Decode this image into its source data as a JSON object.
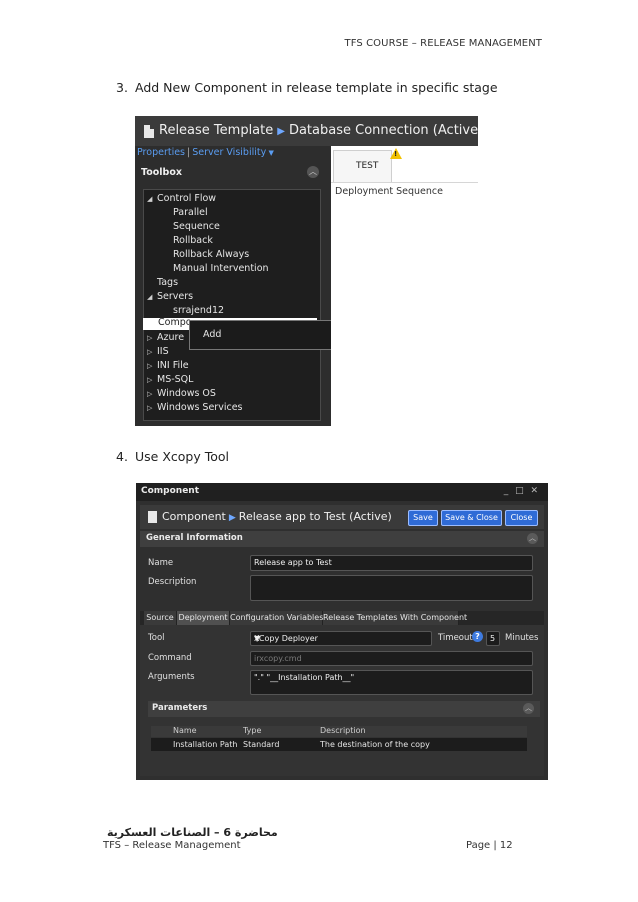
{
  "header": {
    "text": "TFS COURSE – RELEASE MANAGEMENT"
  },
  "steps": [
    {
      "number": "3.",
      "text": "Add New Component in release template in specific stage"
    },
    {
      "number": "4.",
      "text": "Use Xcopy Tool"
    }
  ],
  "screenshot1": {
    "title": "Release Template",
    "subtitle": "Database Connection (Active)",
    "links": {
      "properties": "Properties",
      "separator": "|",
      "server_visibility": "Server Visibility"
    },
    "toolbox_label": "Toolbox",
    "tree": {
      "control_flow": "Control Flow",
      "parallel": "Parallel",
      "sequence": "Sequence",
      "rollback": "Rollback",
      "rollback_always": "Rollback Always",
      "manual_intervention": "Manual Intervention",
      "tags": "Tags",
      "servers": "Servers",
      "server_name": "srrajend12",
      "components_partial": "Compo",
      "azure": "Azure",
      "iis": "IIS",
      "ini_file": "INI File",
      "ms_sql": "MS-SQL",
      "windows_os": "Windows OS",
      "windows_services": "Windows Services"
    },
    "context_menu": {
      "add": "Add"
    },
    "stage_label": "TEST",
    "deployment_sequence": "Deployment Sequence"
  },
  "screenshot2": {
    "window_title": "Component",
    "window_controls": "_ □ ✕",
    "title": "Component",
    "subtitle": "Release app to Test (Active)",
    "buttons": {
      "save": "Save",
      "save_close": "Save & Close",
      "close": "Close"
    },
    "general_information": "General Information",
    "name_label": "Name",
    "name_value": "Release app to Test",
    "description_label": "Description",
    "tabs": [
      "Source",
      "Deployment",
      "Configuration Variables",
      "Release Templates With Component"
    ],
    "tool_label": "Tool",
    "tool_value": "XCopy Deployer",
    "timeout_label": "Timeout",
    "help_glyph": "?",
    "timeout_value": "5",
    "minutes_label": "Minutes",
    "command_label": "Command",
    "command_value": "irxcopy.cmd",
    "arguments_label": "Arguments",
    "arguments_value": "\".\" \"__Installation Path__\"",
    "parameters_label": "Parameters",
    "grid_headers": [
      "Name",
      "Type",
      "Description"
    ],
    "grid_row": [
      "Installation Path",
      "Standard",
      "The destination of the copy"
    ]
  },
  "footer": {
    "arabic": "محاضرة 6 – الصناعات العسكرية",
    "left": "TFS – Release Management",
    "page": "Page | 12"
  }
}
